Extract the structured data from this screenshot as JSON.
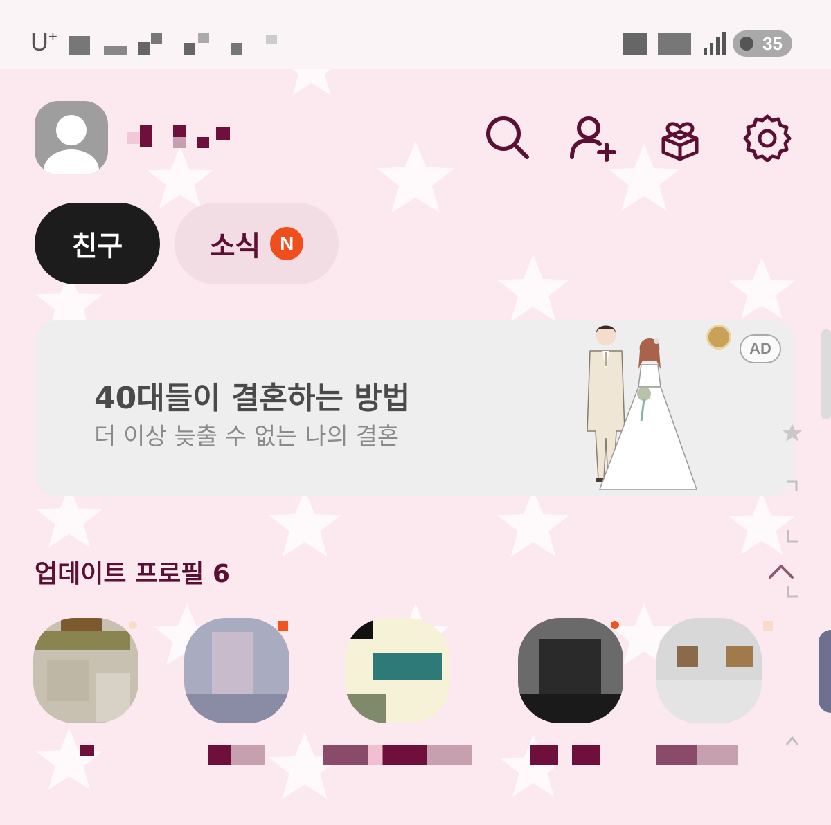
{
  "status_bar": {
    "carrier": "U",
    "carrier_sup": "+",
    "battery_level": "35"
  },
  "header": {
    "avatar": "default-avatar",
    "icons": [
      "search-icon",
      "add-friend-icon",
      "gift-icon",
      "settings-icon"
    ]
  },
  "tabs": [
    {
      "label": "친구",
      "active": true
    },
    {
      "label": "소식",
      "badge": "N",
      "active": false
    }
  ],
  "ad": {
    "title": "40대들이 결혼하는 방법",
    "subtitle": "더 이상 늦출 수 없는 나의 결혼",
    "label": "AD",
    "image": "wedding-couple-illustration"
  },
  "updated_profiles": {
    "title": "업데이트 프로필 6",
    "collapse_icon": "chevron-up-icon",
    "profiles": [
      {
        "has_new": true
      },
      {
        "has_new": true
      },
      {
        "has_new": false
      },
      {
        "has_new": true
      },
      {
        "has_new": true
      }
    ]
  },
  "colors": {
    "accent": "#5b0f33",
    "background": "#fbe9ef",
    "badge": "#f04e1c",
    "active_tab": "#1c1c1c"
  }
}
